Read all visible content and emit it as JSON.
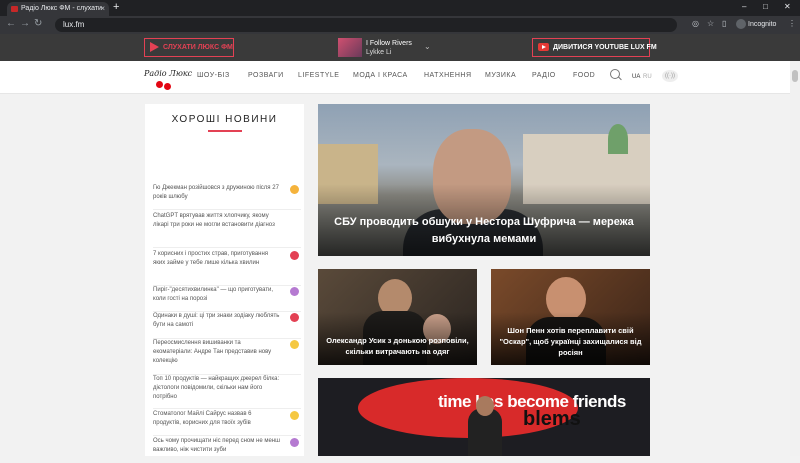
{
  "browser": {
    "tab_title": "Радіо Люкс ФМ - слухати",
    "url": "lux.fm",
    "profile": "Incognito"
  },
  "topbar": {
    "listen_label": "СЛУХАТИ ЛЮКС ФМ",
    "now_playing_title": "I Follow Rivers",
    "now_playing_artist": "Lykke Li",
    "youtube_label": "ДИВИТИСЯ YOUTUBE LUX FM"
  },
  "nav": {
    "logo_text": "Радіо Люкс",
    "items": [
      "ШОУ-БІЗ",
      "РОЗВАГИ",
      "LIFESTYLE",
      "МОДА І КРАСА",
      "НАТХНЕННЯ",
      "МУЗИКА",
      "РАДІО",
      "FOOD"
    ],
    "lang_active": "UA",
    "lang_other": "RU"
  },
  "sidebar": {
    "title": "ХОРОШІ НОВИНИ",
    "items": [
      {
        "text": "Гю Джекман розійшовся з дружиною після 27 років шлюбу",
        "icon": "star-icon",
        "color": "#f5b33c"
      },
      {
        "text": "ChatGPT врятував життя хлопчику, якому лікарі три роки не могли встановити діагноз",
        "icon": "",
        "color": ""
      },
      {
        "text": "7 корисних і простих страв, приготування яких займе у тебе лише кілька хвилин",
        "icon": "food-icon",
        "color": "#e34154"
      },
      {
        "text": "Пиріг-\"десятихвилинка\" — що приготувати, коли гості на порозі",
        "icon": "pen-icon",
        "color": "#b57ad1"
      },
      {
        "text": "Одинаки в душі: ці три знаки зодіаку люблять бути на самоті",
        "icon": "heart-icon",
        "color": "#e34154"
      },
      {
        "text": "Переосмислення вишиванки та екоматеріали: Андре Тан представив нову колекцію",
        "icon": "star-icon",
        "color": "#f5c842"
      },
      {
        "text": "Топ 10 продуктів — найкращих джерел білка: дієтологи повідомили, скільки нам його потрібно",
        "icon": "",
        "color": ""
      },
      {
        "text": "Стоматолог Майлі Сайрус назвав 6 продуктів, корисних для твоїх зубів",
        "icon": "star-icon",
        "color": "#f5c842"
      },
      {
        "text": "Ось чому прочищати ніс перед сном не менш важливо, ніж чистити зуби",
        "icon": "pen-icon",
        "color": "#b57ad1"
      }
    ]
  },
  "articles": {
    "hero_title": "СБУ проводить обшуки у Нестора Шуфрича — мережа вибухнула мемами",
    "card1_title": "Олександр Усик з донькою розповіли, скільки витрачають на одяг",
    "card2_title": "Шон Пенн хотів переплавити свій \"Оскар\", щоб українці захищалися від росіян",
    "banner_text_1": "time has become friends",
    "banner_text_2": "blems"
  }
}
